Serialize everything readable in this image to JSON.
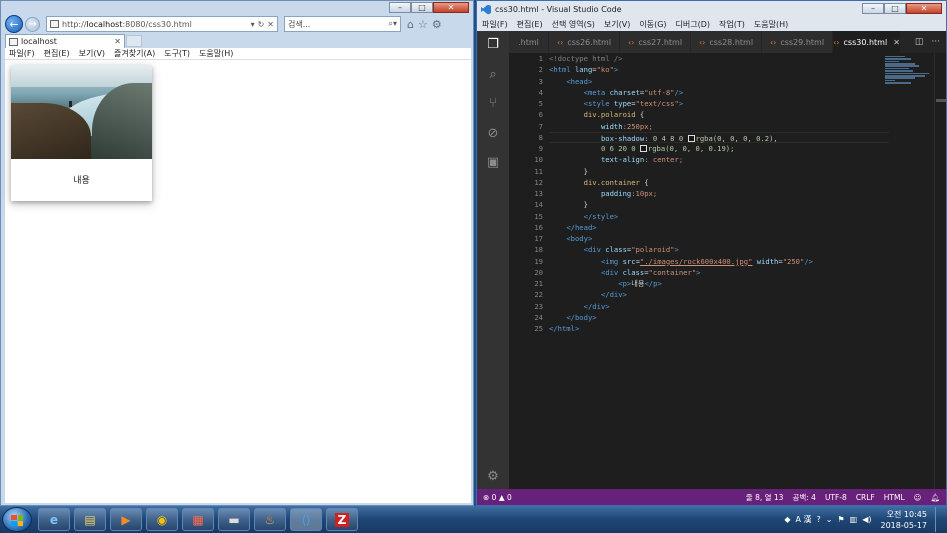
{
  "ie": {
    "address_prefix": "http://",
    "address_host": "localhost",
    "address_rest": ":8080/css30.html",
    "search_placeholder": "검색...",
    "tab_title": "localhost",
    "menu": [
      "파일(F)",
      "편집(E)",
      "보기(V)",
      "즐겨찾기(A)",
      "도구(T)",
      "도움말(H)"
    ],
    "polaroid_caption": "내용"
  },
  "vscode": {
    "window_title": "css30.html - Visual Studio Code",
    "menu": [
      "파일(F)",
      "편집(E)",
      "선택 영역(S)",
      "보기(V)",
      "이동(G)",
      "디버그(D)",
      "작업(T)",
      "도움말(H)"
    ],
    "tabs": [
      ".html",
      "css26.html",
      "css27.html",
      "css28.html",
      "css29.html",
      "css30.html"
    ],
    "active_tab": "css30.html",
    "line_numbers": [
      "1",
      "2",
      "3",
      "4",
      "5",
      "6",
      "7",
      "8",
      "9",
      "10",
      "11",
      "12",
      "13",
      "14",
      "15",
      "16",
      "17",
      "18",
      "19",
      "20",
      "21",
      "22",
      "23",
      "24",
      "25"
    ],
    "status": {
      "errors": "0",
      "warnings": "0",
      "position": "줄 8, 열 13",
      "spaces": "공백: 4",
      "encoding": "UTF-8",
      "eol": "CRLF",
      "language": "HTML"
    }
  },
  "code": {
    "l1": "<!doctype html />",
    "l2_open": "<html ",
    "l2_attr": "lang",
    "l2_eq": "=",
    "l2_val": "\"ko\"",
    "l2_close": ">",
    "l3": "<head>",
    "l4_open": "<meta ",
    "l4_attr": "charset",
    "l4_val": "\"utf-8\"",
    "l4_close": "/>",
    "l5_open": "<style ",
    "l5_attr": "type",
    "l5_val": "\"text/css\"",
    "l5_close": ">",
    "l6_sel": "div.polaroid",
    "l6_brace": " {",
    "l7_prop": "width",
    "l7_val": ":250px;",
    "l8_prop": "box-shadow",
    "l8_val1": ": 0 4 8 0 ",
    "l8_val2": "rgba(0, 0, 0, 0.2),",
    "l9_val1": "0 6 20 0 ",
    "l9_val2": "rgba(0, 0, 0, 0.19);",
    "l10_prop": "text-align",
    "l10_val": ": center;",
    "l11": "}",
    "l12_sel": "div.container",
    "l12_brace": " {",
    "l13_prop": "padding",
    "l13_val": ":10px;",
    "l14": "}",
    "l15": "</style>",
    "l16": "</head>",
    "l17": "<body>",
    "l18_open": "<div ",
    "l18_attr": "class",
    "l18_val": "\"polaroid\"",
    "l18_close": ">",
    "l19_open": "<img ",
    "l19_attr1": "src",
    "l19_val1": "\"./images/rock600x400.jpg\"",
    "l19_attr2": " width",
    "l19_val2": "\"250\"",
    "l19_close": "/>",
    "l20_open": "<div ",
    "l20_attr": "class",
    "l20_val": "\"container\"",
    "l20_close": ">",
    "l21_open": "<p>",
    "l21_text": "내용",
    "l21_close": "</p>",
    "l22": "</div>",
    "l23": "</div>",
    "l24": "</body>",
    "l25": "</html>"
  },
  "taskbar": {
    "time": "오전 10:45",
    "date": "2018-05-17",
    "ime": "A 漢"
  },
  "colors": {
    "vscode_status": "#68217a",
    "vscode_bg": "#1e1e1e",
    "ie_frame": "#c9d9ec"
  }
}
